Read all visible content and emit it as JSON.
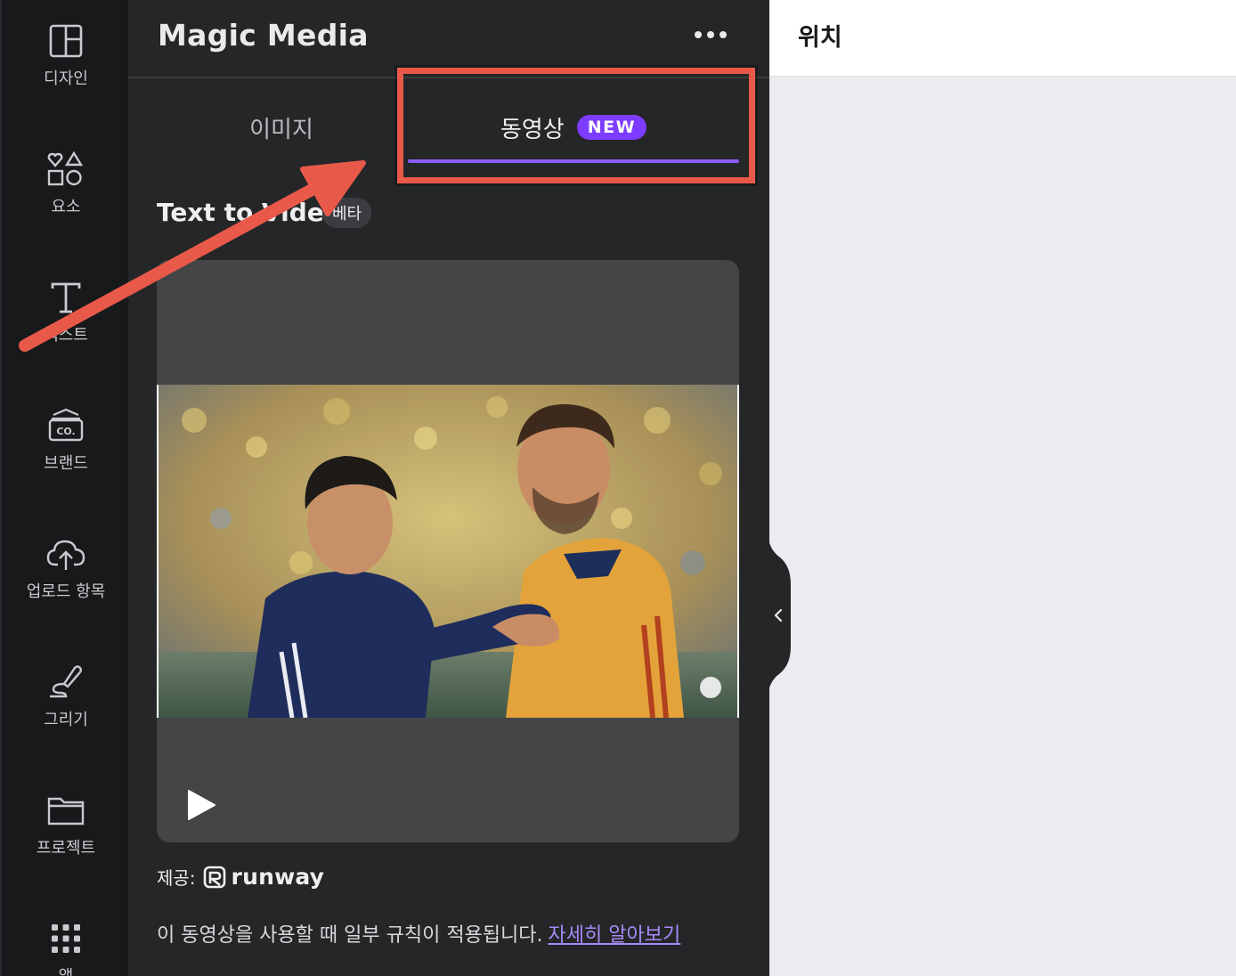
{
  "sidebar": {
    "items": [
      {
        "label": "디자인",
        "icon": "layout-icon"
      },
      {
        "label": "요소",
        "icon": "shapes-icon"
      },
      {
        "label": "텍스트",
        "icon": "text-icon"
      },
      {
        "label": "브랜드",
        "icon": "brand-icon"
      },
      {
        "label": "업로드 항목",
        "icon": "upload-cloud-icon"
      },
      {
        "label": "그리기",
        "icon": "draw-icon"
      },
      {
        "label": "프로젝트",
        "icon": "folder-icon"
      },
      {
        "label": "앱",
        "icon": "apps-grid-icon"
      }
    ]
  },
  "panel": {
    "title": "Magic Media",
    "tabs": [
      {
        "label": "이미지"
      },
      {
        "label": "동영상",
        "badge": "NEW"
      }
    ],
    "section_title": "Text to Video",
    "beta_badge": "베타",
    "provider_prefix": "제공:",
    "provider_name": "runway",
    "notice_text": "이 동영상을 사용할 때 일부 규칙이 적용됩니다.",
    "learn_more": "자세히 알아보기"
  },
  "right_panel": {
    "title": "위치"
  },
  "colors": {
    "accent": "#7d3cff",
    "tab_underline": "#8b5cf6",
    "annotation": "#e8594a",
    "panel_bg": "#252627",
    "rail_bg": "#18191b"
  }
}
